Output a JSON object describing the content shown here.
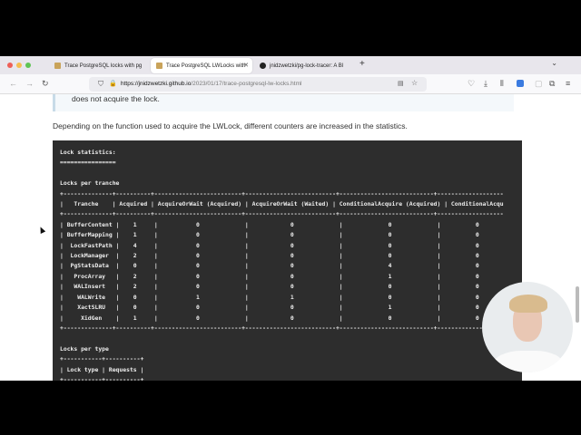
{
  "browser": {
    "tabs": [
      {
        "title": "Trace PostgreSQL locks with pg",
        "active": false
      },
      {
        "title": "Trace PostgreSQL LWLocks with",
        "active": true
      },
      {
        "title": "jnidzwetzki/pg-lock-tracer: A Bl",
        "active": false
      }
    ],
    "url_domain": "https://jnidzwetzki.github.io",
    "url_path": "/2023/01/17/trace-postgresql-lw-locks.html"
  },
  "article": {
    "note_text": "does not acquire the lock.",
    "paragraph": "Depending on the function used to acquire the LWLock, different counters are increased in the statistics.",
    "code": "Lock statistics:\n================\n\nLocks per tranche\n+--------------+----------+-------------------------+--------------------------+---------------------------+-------------------\n|   Tranche    | Acquired | AcquireOrWait (Acquired) | AcquireOrWait (Waited) | ConditionalAcquire (Acquired) | ConditionalAcqu\n+--------------+----------+-------------------------+--------------------------+---------------------------+-------------------\n| BufferContent |    1     |           0             |            0             |             0             |          0\n| BufferMapping |    1     |           0             |            0             |             0             |          0\n|  LockFastPath |    4     |           0             |            0             |             0             |          0\n|  LockManager  |    2     |           0             |            0             |             0             |          0\n|  PgStatsData  |    0     |           0             |            0             |             4             |          0\n|   ProcArray   |    2     |           0             |            0             |             1             |          0\n|   WALInsert   |    2     |           0             |            0             |             0             |          0\n|    WALWrite   |    0     |           1             |            1             |             0             |          0\n|    XactSLRU   |    0     |           0             |            0             |             1             |          0\n|     XidGen    |    1     |           0             |            0             |             0             |          0\n+--------------+----------+-------------------------+--------------------------+---------------------------+-------------------\n\nLocks per type\n+-----------+----------+\n| Lock type | Requests |\n+-----------+----------+"
  }
}
